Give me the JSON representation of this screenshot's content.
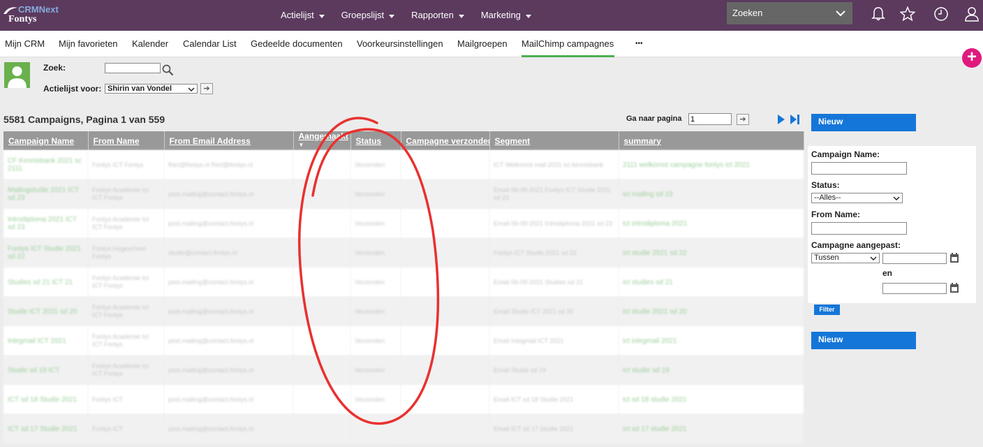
{
  "topbar": {
    "logo_crm": "CRMNext",
    "logo_fontys": "Fontys",
    "nav": [
      "Actielijst",
      "Groepslijst",
      "Rapporten",
      "Marketing"
    ],
    "search_label": "Zoeken"
  },
  "tabs": [
    "Mijn CRM",
    "Mijn favorieten",
    "Kalender",
    "Calendar List",
    "Gedeelde documenten",
    "Voorkeursinstellingen",
    "Mailgroepen",
    "MailChimp campagnes",
    "•••"
  ],
  "active_tab": "MailChimp campagnes",
  "search": {
    "zoek_label": "Zoek:",
    "zoek_value": "",
    "actielijst_label": "Actielijst voor:",
    "actielijst_value": "Shirin van Vondel",
    "go_glyph": "➔"
  },
  "listing": {
    "title": "5581 Campaigns, Pagina 1 van 559",
    "goto_label": "Ga naar pagina",
    "goto_value": "1"
  },
  "table": {
    "columns": [
      "Campaign Name",
      "From Name",
      "From Email Address",
      "Aangemaakt",
      "Status",
      "Campagne verzonden",
      "Segment",
      "summary"
    ],
    "rows": [
      [
        "CF Kennisbank 2021 sc 2111",
        "Fontys ICT Fontys",
        "fhict@fontys.nl fhict@fontys.nl",
        "",
        "Verzonden",
        "",
        "ICT Welkomst mail 2021 ict kennisbank",
        "2111 welkomst campagne fontys ict 2021"
      ],
      [
        "Mailingstudie 2021 ICT sd 23",
        "Fontys Academie Ict ICT Fontys",
        "post.mailing@contact.fontys.nl",
        "",
        "Verzonden",
        "",
        "Email 06-09-2021 Fontys ICT Studie 2021 sd 23",
        "ict mailing sd 23"
      ],
      [
        "Introdiploma 2021 ICT sd 23",
        "Fontys Academie Ict ICT Fontys",
        "post.mailing@contact.fontys.nl",
        "",
        "Verzonden",
        "",
        "Email 06-09-2021 Introdiploma 2021 sd 23",
        "ict introdiploma 2021"
      ],
      [
        "Fontys ICT Studie 2021 sd 22",
        "Fontys Hogeschool Fontys",
        "studie@contact.fontys.nl",
        "",
        "Verzonden",
        "",
        "Fontys ICT Studie 2021 sd 22",
        "ict studie 2021 sd 22"
      ],
      [
        "Studies sd 21 ICT 21",
        "Fontys Academie Ict ICT Fontys",
        "post.mailing@contact.fontys.nl",
        "",
        "Verzonden",
        "",
        "Email 06-09-2021 Studies sd 21",
        "ict studies sd 21"
      ],
      [
        "Studie ICT 2021 sd 20",
        "Fontys Academie Ict ICT Fontys",
        "post.mailing@contact.fontys.nl",
        "",
        "Verzonden",
        "",
        "Email Studie ICT 2021 sd 20",
        "ict studie 2021 sd 20"
      ],
      [
        "Inlegmail ICT 2021",
        "Fontys Academie Ict ICT Fontys",
        "post.mailing@contact.fontys.nl",
        "",
        "Verzonden",
        "",
        "Email Inlegmail ICT 2021",
        "ict inlegmail 2021"
      ],
      [
        "Studie sd 19 ICT",
        "Fontys Academie Ict ICT Fontys",
        "post.mailing@contact.fontys.nl",
        "",
        "Verzonden",
        "",
        "Email Studie sd 19",
        "ict studie sd 19"
      ],
      [
        "ICT sd 18 Studie 2021",
        "Fontys ICT",
        "post.mailing@contact.fontys.nl",
        "",
        "Verzonden",
        "",
        "Email ICT sd 18 Studie 2021",
        "ict sd 18 studie 2021"
      ],
      [
        "ICT sd 17 Studie 2021",
        "Fontys ICT",
        "post.mailing@contact.fontys.nl",
        "",
        "",
        "",
        "Email ICT sd 17 Studie 2021",
        "ict sd 17 studie 2021"
      ]
    ]
  },
  "sidepanel": {
    "nieuw_label": "Nieuw",
    "campaign_name_label": "Campaign Name:",
    "status_label": "Status:",
    "status_value": "--Alles--",
    "from_name_label": "From Name:",
    "campagne_label": "Campagne aangepast:",
    "range_value": "Tussen",
    "en_label": "en",
    "filter_label": "Filter"
  }
}
